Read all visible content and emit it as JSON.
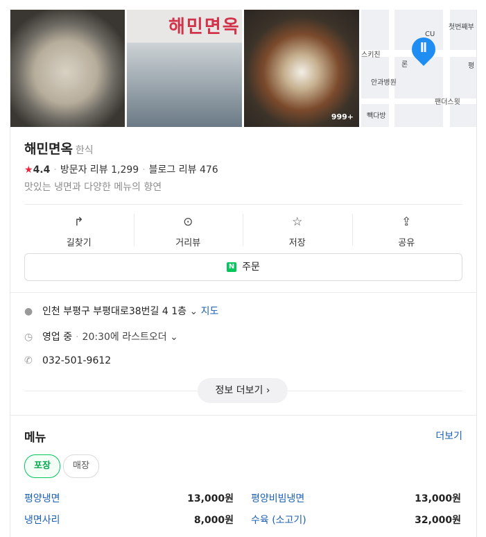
{
  "photos": {
    "storefront_sign": "해민면옥",
    "photo_count_badge": "999+",
    "map_labels": [
      "CU",
      "첫번째부",
      "스키친",
      "론",
      "안과병원",
      "평",
      "팬더스윗",
      "빽다방"
    ]
  },
  "place": {
    "name": "해민면옥",
    "category": "한식",
    "rating": "4.4",
    "visitor_reviews": "방문자 리뷰 1,299",
    "blog_reviews": "블로그 리뷰 476",
    "description": "맛있는 냉면과 다양한 메뉴의 향연"
  },
  "actions": [
    {
      "label": "길찾기",
      "icon": "↱"
    },
    {
      "label": "거리뷰",
      "icon": "⊙"
    },
    {
      "label": "저장",
      "icon": "☆"
    },
    {
      "label": "공유",
      "icon": "⇪"
    }
  ],
  "order": {
    "label": "주문",
    "n_glyph": "N"
  },
  "info": {
    "address": "인천 부평구 부평대로38번길 4 1층",
    "map_link": "지도",
    "status": "영업 중",
    "hours": "20:30에 라스트오더",
    "phone": "032-501-9612"
  },
  "more_info": "정보 더보기",
  "menu": {
    "heading": "메뉴",
    "more": "더보기",
    "tabs": [
      "포장",
      "매장"
    ],
    "items": [
      {
        "name": "평양냉면",
        "price": "13,000원"
      },
      {
        "name": "평양비빔냉면",
        "price": "13,000원"
      },
      {
        "name": "냉면사리",
        "price": "8,000원"
      },
      {
        "name": "수육 (소고기)",
        "price": "32,000원"
      }
    ]
  },
  "colors": {
    "rating_star": "#f0243b",
    "naver_green": "#03c75a",
    "link_blue": "#1a5fb4",
    "map_pin": "#1f8df2"
  }
}
